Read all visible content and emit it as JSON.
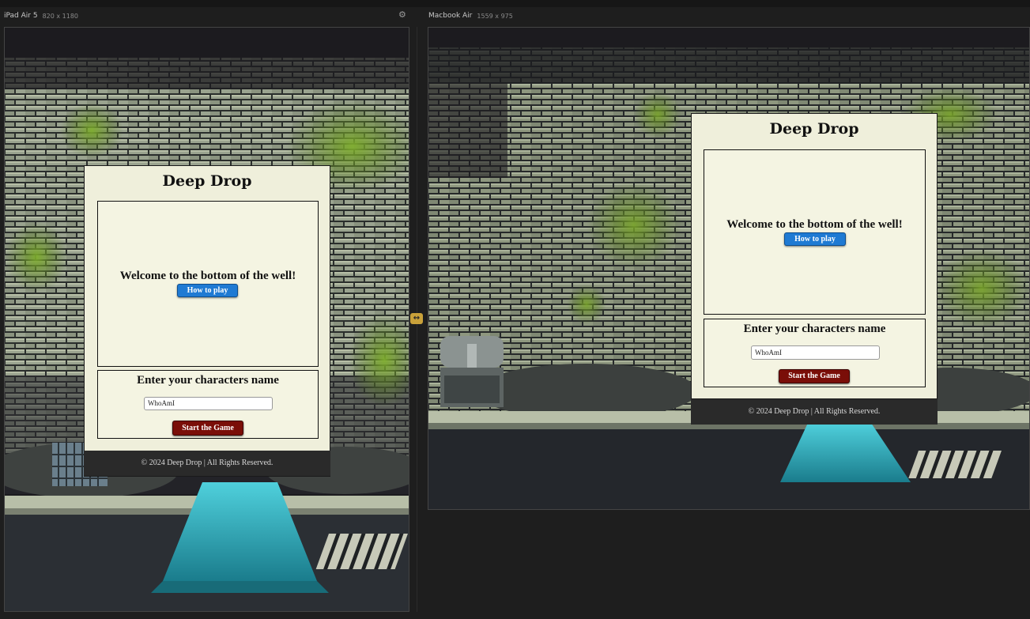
{
  "devices": [
    {
      "name": "iPad Air 5",
      "size": "820 x 1180"
    },
    {
      "name": "Macbook Air",
      "size": "1559 x 975"
    }
  ],
  "app": {
    "title": "Deep Drop",
    "welcome": "Welcome to the bottom of the well!",
    "how_to_play": "How to play",
    "name_heading": "Enter your characters name",
    "name_value": "WhoAmI",
    "start_button": "Start the Game",
    "footer": "© 2024 Deep Drop | All Rights Reserved."
  },
  "colors": {
    "card_bg": "#efefdb",
    "how_button": "#1f7ad3",
    "start_button": "#7a0e08",
    "footer_bg": "#2a2a2a",
    "splitter": "#c9a13a"
  },
  "icons": {
    "settings": "gear-icon",
    "resize": "resize-handle-icon"
  }
}
